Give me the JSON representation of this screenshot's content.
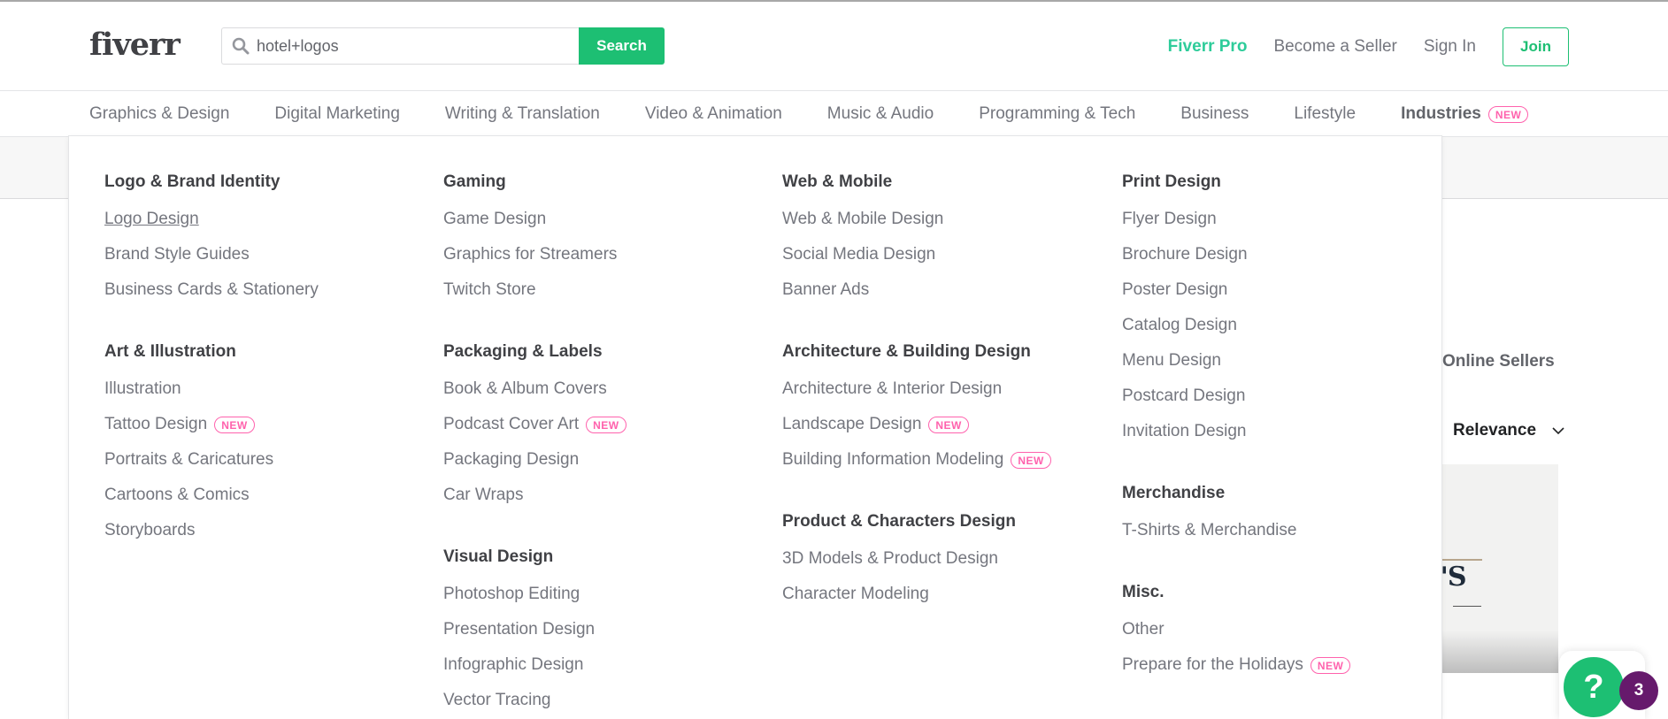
{
  "header": {
    "logo": "fiverr",
    "search": {
      "value": "hotel+logos",
      "placeholder": "",
      "button_label": "Search",
      "icon": "search-icon"
    },
    "links": {
      "pro": "Fiverr Pro",
      "become_seller": "Become a Seller",
      "sign_in": "Sign In",
      "join": "Join"
    }
  },
  "categories": [
    {
      "label": "Graphics & Design",
      "active": true
    },
    {
      "label": "Digital Marketing"
    },
    {
      "label": "Writing & Translation"
    },
    {
      "label": "Video & Animation"
    },
    {
      "label": "Music & Audio"
    },
    {
      "label": "Programming & Tech"
    },
    {
      "label": "Business"
    },
    {
      "label": "Lifestyle"
    },
    {
      "label": "Industries",
      "badge": "NEW"
    }
  ],
  "badge_text": "NEW",
  "dropdown": {
    "columns": [
      [
        {
          "title": "Logo & Brand Identity",
          "items": [
            {
              "label": "Logo Design",
              "underlined": true
            },
            {
              "label": "Brand Style Guides"
            },
            {
              "label": "Business Cards & Stationery"
            }
          ]
        },
        {
          "title": "Art & Illustration",
          "items": [
            {
              "label": "Illustration"
            },
            {
              "label": "Tattoo Design",
              "badge": "NEW"
            },
            {
              "label": "Portraits & Caricatures"
            },
            {
              "label": "Cartoons & Comics"
            },
            {
              "label": "Storyboards"
            }
          ]
        }
      ],
      [
        {
          "title": "Gaming",
          "items": [
            {
              "label": "Game Design"
            },
            {
              "label": "Graphics for Streamers"
            },
            {
              "label": "Twitch Store"
            }
          ]
        },
        {
          "title": "Packaging & Labels",
          "items": [
            {
              "label": "Book & Album Covers"
            },
            {
              "label": "Podcast Cover Art",
              "badge": "NEW"
            },
            {
              "label": "Packaging Design"
            },
            {
              "label": "Car Wraps"
            }
          ]
        },
        {
          "title": "Visual Design",
          "items": [
            {
              "label": "Photoshop Editing"
            },
            {
              "label": "Presentation Design"
            },
            {
              "label": "Infographic Design"
            },
            {
              "label": "Vector Tracing"
            }
          ]
        }
      ],
      [
        {
          "title": "Web & Mobile",
          "items": [
            {
              "label": "Web & Mobile Design"
            },
            {
              "label": "Social Media Design"
            },
            {
              "label": "Banner Ads"
            }
          ]
        },
        {
          "title": "Architecture & Building Design",
          "items": [
            {
              "label": "Architecture & Interior Design"
            },
            {
              "label": "Landscape Design",
              "badge": "NEW"
            },
            {
              "label": "Building Information Modeling",
              "badge": "NEW"
            }
          ]
        },
        {
          "title": "Product & Characters Design",
          "items": [
            {
              "label": "3D Models & Product Design"
            },
            {
              "label": "Character Modeling"
            }
          ]
        }
      ],
      [
        {
          "title": "Print Design",
          "items": [
            {
              "label": "Flyer Design"
            },
            {
              "label": "Brochure Design"
            },
            {
              "label": "Poster Design"
            },
            {
              "label": "Catalog Design"
            },
            {
              "label": "Menu Design"
            },
            {
              "label": "Postcard Design"
            },
            {
              "label": "Invitation Design"
            }
          ]
        },
        {
          "title": "Merchandise",
          "items": [
            {
              "label": "T-Shirts & Merchandise"
            }
          ]
        },
        {
          "title": "Misc.",
          "items": [
            {
              "label": "Other"
            },
            {
              "label": "Prepare for the Holidays",
              "badge": "NEW"
            }
          ]
        }
      ]
    ]
  },
  "background": {
    "online_sellers": "Online Sellers",
    "sort_label": "Relevance",
    "gig_image_text": "IG'S"
  },
  "help": {
    "icon": "?",
    "count": "3"
  },
  "colors": {
    "brand_green": "#1dbf73",
    "pro_teal": "#2ecc9a",
    "new_pink": "#ff62ad",
    "help_purple": "#661a6c"
  }
}
